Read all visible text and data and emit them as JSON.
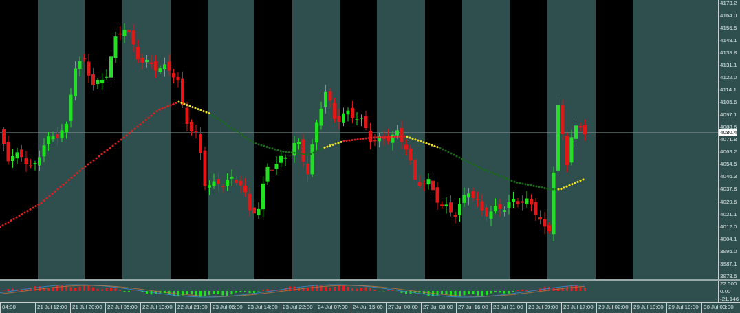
{
  "price_axis": {
    "labels": [
      "4173.2",
      "4164.0",
      "4156.5",
      "4148.1",
      "4139.8",
      "4131.1",
      "4122.0",
      "4114.1",
      "4105.6",
      "4097.1",
      "4088.6",
      "4071.8",
      "4063.2",
      "4054.5",
      "4046.3",
      "4037.8",
      "4029.6",
      "4021.1",
      "4012.0",
      "4004.1",
      "3995.0",
      "3987.1",
      "3978.6"
    ],
    "current_price": "4080.4"
  },
  "indicator_axis": {
    "labels": [
      "22.500",
      "0.00",
      "-21.146"
    ]
  },
  "time_axis": {
    "labels": [
      "04:00",
      "21 Jul 12:00",
      "21 Jul 20:00",
      "22 Jul 05:00",
      "22 Jul 13:00",
      "22 Jul 21:00",
      "23 Jul 06:00",
      "23 Jul 14:00",
      "23 Jul 22:00",
      "24 Jul 07:00",
      "24 Jul 15:00",
      "27 Jul 00:00",
      "27 Jul 08:00",
      "27 Jul 16:00",
      "28 Jul 01:00",
      "28 Jul 09:00",
      "28 Jul 17:00",
      "29 Jul 02:00",
      "29 Jul 10:00",
      "29 Jul 18:00",
      "30 Jul 03:00"
    ]
  }
}
